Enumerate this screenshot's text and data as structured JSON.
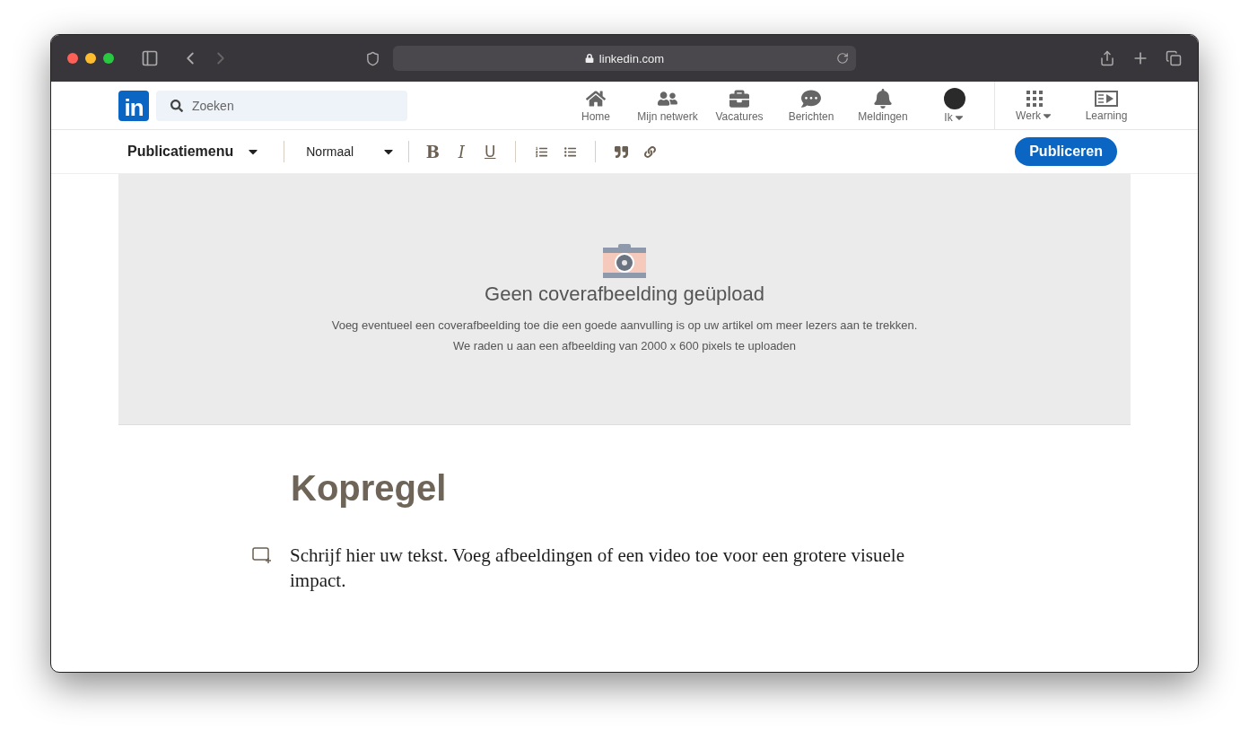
{
  "browser": {
    "url": "linkedin.com"
  },
  "nav": {
    "logo": "in",
    "search": {
      "placeholder": "Zoeken"
    },
    "items": [
      {
        "label": "Home",
        "dropdown": false
      },
      {
        "label": "Mijn netwerk",
        "dropdown": false
      },
      {
        "label": "Vacatures",
        "dropdown": false
      },
      {
        "label": "Berichten",
        "dropdown": false
      },
      {
        "label": "Meldingen",
        "dropdown": false
      },
      {
        "label": "Ik",
        "dropdown": true
      }
    ],
    "extra": [
      {
        "label": "Werk",
        "dropdown": true
      },
      {
        "label": "Learning",
        "dropdown": false
      }
    ]
  },
  "toolbar": {
    "menu": "Publicatiemenu",
    "style": "Normaal",
    "format": [
      "B",
      "I",
      "U"
    ],
    "publish": "Publiceren"
  },
  "cover": {
    "title": "Geen coverafbeelding geüpload",
    "lines": [
      "Voeg eventueel een coverafbeelding toe die een goede aanvulling is op uw artikel om meer lezers aan te trekken.",
      "We raden u aan een afbeelding van 2000 x 600 pixels te uploaden"
    ]
  },
  "article": {
    "headline": {
      "placeholder": "Kopregel"
    },
    "body": {
      "placeholder": "Schrijf hier uw tekst. Voeg afbeeldingen of een video toe voor een grotere visuele impact."
    }
  }
}
